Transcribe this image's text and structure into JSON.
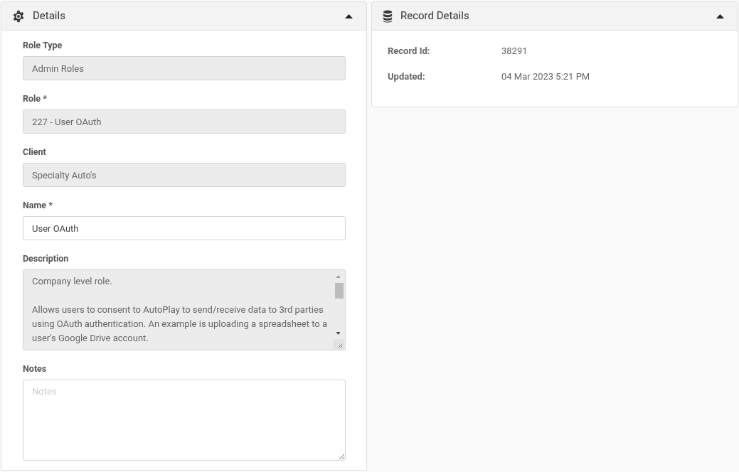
{
  "details_panel": {
    "title": "Details",
    "expanded": true,
    "fields": [
      {
        "label": "Role Type",
        "kind": "input",
        "value": "Admin Roles",
        "disabled": true
      },
      {
        "label": "Role *",
        "kind": "input",
        "value": "227 - User OAuth",
        "disabled": true
      },
      {
        "label": "Client",
        "kind": "input",
        "value": "Specialty Auto's",
        "disabled": true
      },
      {
        "label": "Name *",
        "kind": "input",
        "value": "User OAuth",
        "disabled": false
      },
      {
        "label": "Description",
        "kind": "textarea",
        "value": "Company level role.\n\nAllows users to consent to AutoPlay to send/receive data to 3rd parties using OAuth authentication. An example is uploading a spreadsheet to a user's Google Drive account.",
        "disabled": true
      },
      {
        "label": "Notes",
        "kind": "textarea",
        "placeholder": "Notes",
        "disabled": false
      }
    ]
  },
  "record_panel": {
    "title": "Record Details",
    "expanded": true,
    "rows": [
      {
        "label": "Record Id:",
        "value": "38291"
      },
      {
        "label": "Updated:",
        "value": "04 Mar 2023 5:21 PM"
      }
    ]
  }
}
